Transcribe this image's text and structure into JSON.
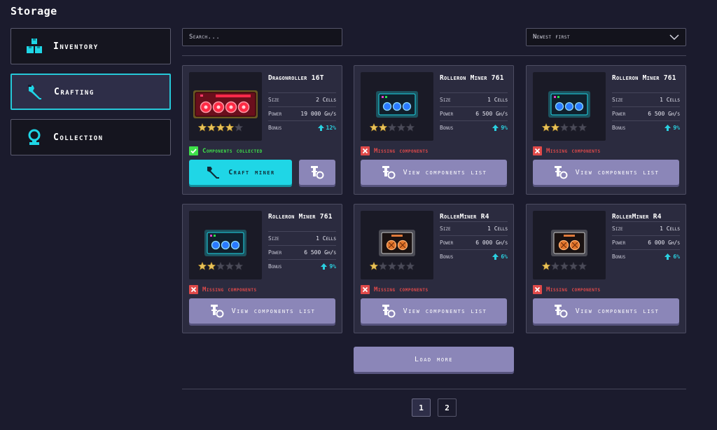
{
  "title": "Storage",
  "sidebar": {
    "items": [
      {
        "label": "Inventory",
        "icon": "boxes-icon",
        "active": false
      },
      {
        "label": "Crafting",
        "icon": "wrench-icon",
        "active": true
      },
      {
        "label": "Collection",
        "icon": "trophy-icon",
        "active": false
      }
    ]
  },
  "toolbar": {
    "search_placeholder": "Search...",
    "sort_value": "Newest first"
  },
  "labels": {
    "size": "Size",
    "power": "Power",
    "bonus": "Bonus",
    "collected": "Components collected",
    "missing": "Missing components",
    "craft": "Craft miner",
    "view_list": "View components list",
    "load_more": "Load more"
  },
  "cards": [
    {
      "name": "Dragonroller 16T",
      "size": "2 Cells",
      "power": "19 000 Gh/s",
      "bonus": "12%",
      "rating": 4,
      "collected": true,
      "style": "red4"
    },
    {
      "name": "Rolleron Miner 761",
      "size": "1 Cells",
      "power": "6 500 Gh/s",
      "bonus": "9%",
      "rating": 2,
      "collected": false,
      "style": "blue3"
    },
    {
      "name": "Rolleron Miner 761",
      "size": "1 Cells",
      "power": "6 500 Gh/s",
      "bonus": "9%",
      "rating": 2,
      "collected": false,
      "style": "blue3"
    },
    {
      "name": "Rolleron Miner 761",
      "size": "1 Cells",
      "power": "6 500 Gh/s",
      "bonus": "9%",
      "rating": 2,
      "collected": false,
      "style": "blue3"
    },
    {
      "name": "RollerMiner R4",
      "size": "1 Cells",
      "power": "6 000 Gh/s",
      "bonus": "6%",
      "rating": 1,
      "collected": false,
      "style": "orange2"
    },
    {
      "name": "RollerMiner R4",
      "size": "1 Cells",
      "power": "6 000 Gh/s",
      "bonus": "6%",
      "rating": 1,
      "collected": false,
      "style": "orange2"
    }
  ],
  "pagination": {
    "pages": [
      "1",
      "2"
    ],
    "current": "1"
  },
  "colors": {
    "accent": "#1fd6e6",
    "button": "#8b86b8",
    "success": "#3ee04a",
    "danger": "#e04a4a",
    "star": "#e8c25a"
  }
}
